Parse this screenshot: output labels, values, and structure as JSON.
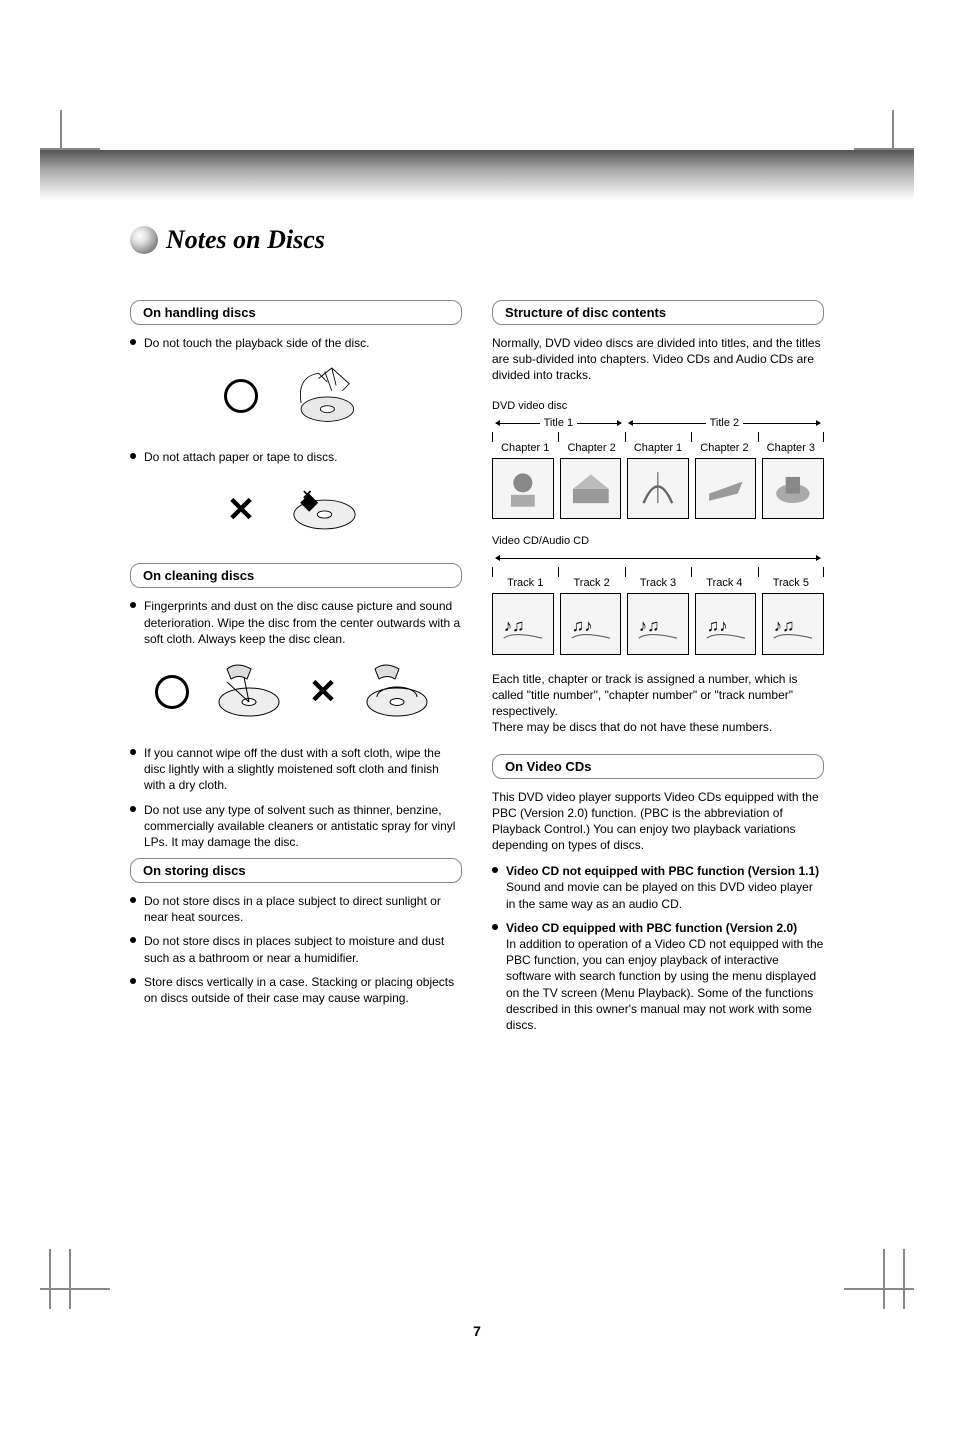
{
  "page_title": "Notes on Discs",
  "page_number": "7",
  "left_column": {
    "handling": {
      "header": "On handling discs",
      "bullet1": "Do not touch the playback side of the disc.",
      "bullet2": "Do not attach paper or tape to discs."
    },
    "cleaning": {
      "header": "On cleaning discs",
      "bullet1": "Fingerprints and dust on the disc cause picture and sound deterioration. Wipe the disc from the center outwards with a soft cloth. Always keep the disc clean.",
      "bullet2": "If you cannot wipe off the dust with a soft cloth, wipe the disc lightly with a slightly moistened soft cloth and finish with a dry cloth.",
      "bullet3": "Do not use any type of solvent such as thinner, benzine, commercially available cleaners or antistatic spray for vinyl LPs. It may damage the disc."
    },
    "storing": {
      "header": "On storing discs",
      "bullet1": "Do not store discs in a place subject to direct sunlight or near heat sources.",
      "bullet2": "Do not store discs in places subject to moisture and dust such as a bathroom or near a humidifier.",
      "bullet3": "Store discs vertically in a case. Stacking or placing objects on discs outside of their case may cause warping."
    }
  },
  "right_column": {
    "structure": {
      "header": "Structure of disc contents",
      "intro": "Normally, DVD video discs are divided into titles, and the titles are sub-divided into chapters. Video CDs and Audio CDs are divided into tracks.",
      "dvd_label": "DVD video disc",
      "title1": "Title 1",
      "title2": "Title 2",
      "chapter1": "Chapter 1",
      "chapter2": "Chapter 2",
      "chapter3": "Chapter 1",
      "chapter4": "Chapter 2",
      "chapter5": "Chapter 3",
      "cd_label": "Video CD/Audio CD",
      "track1": "Track 1",
      "track2": "Track 2",
      "track3": "Track 3",
      "track4": "Track 4",
      "track5": "Track 5",
      "outro": "Each title, chapter or track is assigned a number, which is called \"title number\", \"chapter number\" or \"track number\" respectively.\nThere may be discs that do not have these numbers."
    },
    "video_cds": {
      "header": "On Video CDs",
      "text": "This DVD video player supports Video CDs equipped with the PBC (Version 2.0) function. (PBC is the abbreviation of Playback Control.) You can enjoy two playback variations depending on types of discs.",
      "type1_label": "Video CD not equipped with PBC function (Version 1.1)",
      "type1_text": "Sound and movie can be played on this DVD video player in the same way as an audio CD.",
      "type2_label": "Video CD equipped with PBC function (Version 2.0)",
      "type2_text": "In addition to operation of a Video CD not equipped with the PBC function, you can enjoy playback of interactive software with search function by using the menu displayed on the TV screen (Menu Playback). Some of the functions described in this owner's manual may not work with some discs."
    }
  }
}
